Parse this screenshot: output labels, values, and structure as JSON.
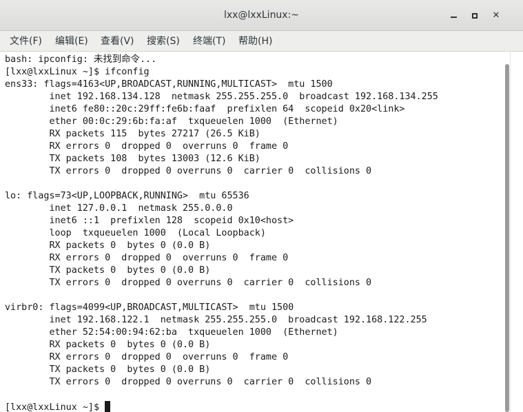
{
  "window": {
    "title": "lxx@lxxLinux:~",
    "controls": {
      "minimize": "minimize-icon",
      "maximize": "maximize-icon",
      "close": "close-icon"
    }
  },
  "menubar": {
    "file": "文件(F)",
    "edit": "编辑(E)",
    "view": "查看(V)",
    "search": "搜索(S)",
    "terminal": "终端(T)",
    "help": "帮助(H)"
  },
  "terminal": {
    "lines": [
      "bash: ipconfig: 未找到命令...",
      "[lxx@lxxLinux ~]$ ifconfig",
      "ens33: flags=4163<UP,BROADCAST,RUNNING,MULTICAST>  mtu 1500",
      "        inet 192.168.134.128  netmask 255.255.255.0  broadcast 192.168.134.255",
      "        inet6 fe80::20c:29ff:fe6b:faaf  prefixlen 64  scopeid 0x20<link>",
      "        ether 00:0c:29:6b:fa:af  txqueuelen 1000  (Ethernet)",
      "        RX packets 115  bytes 27217 (26.5 KiB)",
      "        RX errors 0  dropped 0  overruns 0  frame 0",
      "        TX packets 108  bytes 13003 (12.6 KiB)",
      "        TX errors 0  dropped 0 overruns 0  carrier 0  collisions 0",
      "",
      "lo: flags=73<UP,LOOPBACK,RUNNING>  mtu 65536",
      "        inet 127.0.0.1  netmask 255.0.0.0",
      "        inet6 ::1  prefixlen 128  scopeid 0x10<host>",
      "        loop  txqueuelen 1000  (Local Loopback)",
      "        RX packets 0  bytes 0 (0.0 B)",
      "        RX errors 0  dropped 0  overruns 0  frame 0",
      "        TX packets 0  bytes 0 (0.0 B)",
      "        TX errors 0  dropped 0 overruns 0  carrier 0  collisions 0",
      "",
      "virbr0: flags=4099<UP,BROADCAST,MULTICAST>  mtu 1500",
      "        inet 192.168.122.1  netmask 255.255.255.0  broadcast 192.168.122.255",
      "        ether 52:54:00:94:62:ba  txqueuelen 1000  (Ethernet)",
      "        RX packets 0  bytes 0 (0.0 B)",
      "        RX errors 0  dropped 0  overruns 0  frame 0",
      "        TX packets 0  bytes 0 (0.0 B)",
      "        TX errors 0  dropped 0 overruns 0  carrier 0  collisions 0",
      ""
    ],
    "prompt": "[lxx@lxxLinux ~]$ "
  }
}
